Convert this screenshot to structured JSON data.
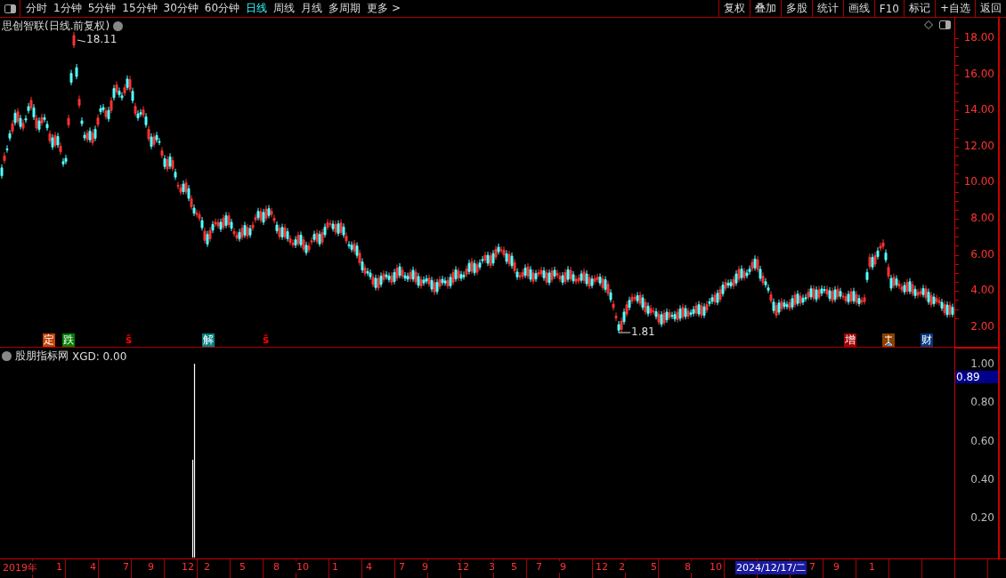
{
  "toolbar": {
    "periods": [
      {
        "label": "分时",
        "selected": false
      },
      {
        "label": "1分钟",
        "selected": false
      },
      {
        "label": "5分钟",
        "selected": false
      },
      {
        "label": "15分钟",
        "selected": false
      },
      {
        "label": "30分钟",
        "selected": false
      },
      {
        "label": "60分钟",
        "selected": false
      },
      {
        "label": "日线",
        "selected": true
      },
      {
        "label": "周线",
        "selected": false
      },
      {
        "label": "月线",
        "selected": false
      },
      {
        "label": "多周期",
        "selected": false
      },
      {
        "label": "更多 >",
        "selected": false
      }
    ],
    "buttons": [
      "复权",
      "叠加",
      "多股",
      "统计",
      "画线",
      "F10",
      "标记",
      "+自选",
      "返回"
    ]
  },
  "price_panel": {
    "title": "思创智联(日线.前复权)",
    "high_label": "18.11",
    "low_label": "1.81",
    "axis": [
      "18.00",
      "16.00",
      "14.00",
      "12.00",
      "10.00",
      "8.00",
      "6.00",
      "4.00",
      "2.00"
    ],
    "markers": [
      {
        "kind": "text",
        "label": "定",
        "color": "#c04000"
      },
      {
        "kind": "text",
        "label": "跌",
        "color": "#008000"
      },
      {
        "kind": "arrow",
        "label": "ŝ",
        "color": "#ff0000"
      },
      {
        "kind": "text",
        "label": "解",
        "color": "#008080"
      },
      {
        "kind": "arrow",
        "label": "ŝ",
        "color": "#ff0000"
      },
      {
        "kind": "text",
        "label": "增",
        "color": "#a00000"
      },
      {
        "kind": "icon",
        "color": "#8b4000"
      },
      {
        "kind": "text",
        "label": "财",
        "color": "#003a80"
      }
    ]
  },
  "indicator_panel": {
    "title": "股朋指标网",
    "reading": "XGD: 0.00",
    "axis": [
      "1.00",
      "0.80",
      "0.60",
      "0.40",
      "0.20"
    ],
    "cursor_value": "0.89"
  },
  "date_axis": [
    {
      "label": "2019年",
      "selected": false
    },
    {
      "label": "1",
      "selected": false
    },
    {
      "label": "4",
      "selected": false
    },
    {
      "label": "7",
      "selected": false
    },
    {
      "label": "9",
      "selected": false
    },
    {
      "label": "12",
      "selected": false
    },
    {
      "label": "2",
      "selected": false
    },
    {
      "label": "5",
      "selected": false
    },
    {
      "label": "8",
      "selected": false
    },
    {
      "label": "10",
      "selected": false
    },
    {
      "label": "1",
      "selected": false
    },
    {
      "label": "4",
      "selected": false
    },
    {
      "label": "7",
      "selected": false
    },
    {
      "label": "9",
      "selected": false
    },
    {
      "label": "12",
      "selected": false
    },
    {
      "label": "3",
      "selected": false
    },
    {
      "label": "5",
      "selected": false
    },
    {
      "label": "7",
      "selected": false
    },
    {
      "label": "9",
      "selected": false
    },
    {
      "label": "12",
      "selected": false
    },
    {
      "label": "2",
      "selected": false
    },
    {
      "label": "5",
      "selected": false
    },
    {
      "label": "8",
      "selected": false
    },
    {
      "label": "10",
      "selected": false
    },
    {
      "label": "2024/12/17/二",
      "selected": true
    },
    {
      "label": "7",
      "selected": false
    },
    {
      "label": "9",
      "selected": false
    },
    {
      "label": "1",
      "selected": false
    }
  ]
}
